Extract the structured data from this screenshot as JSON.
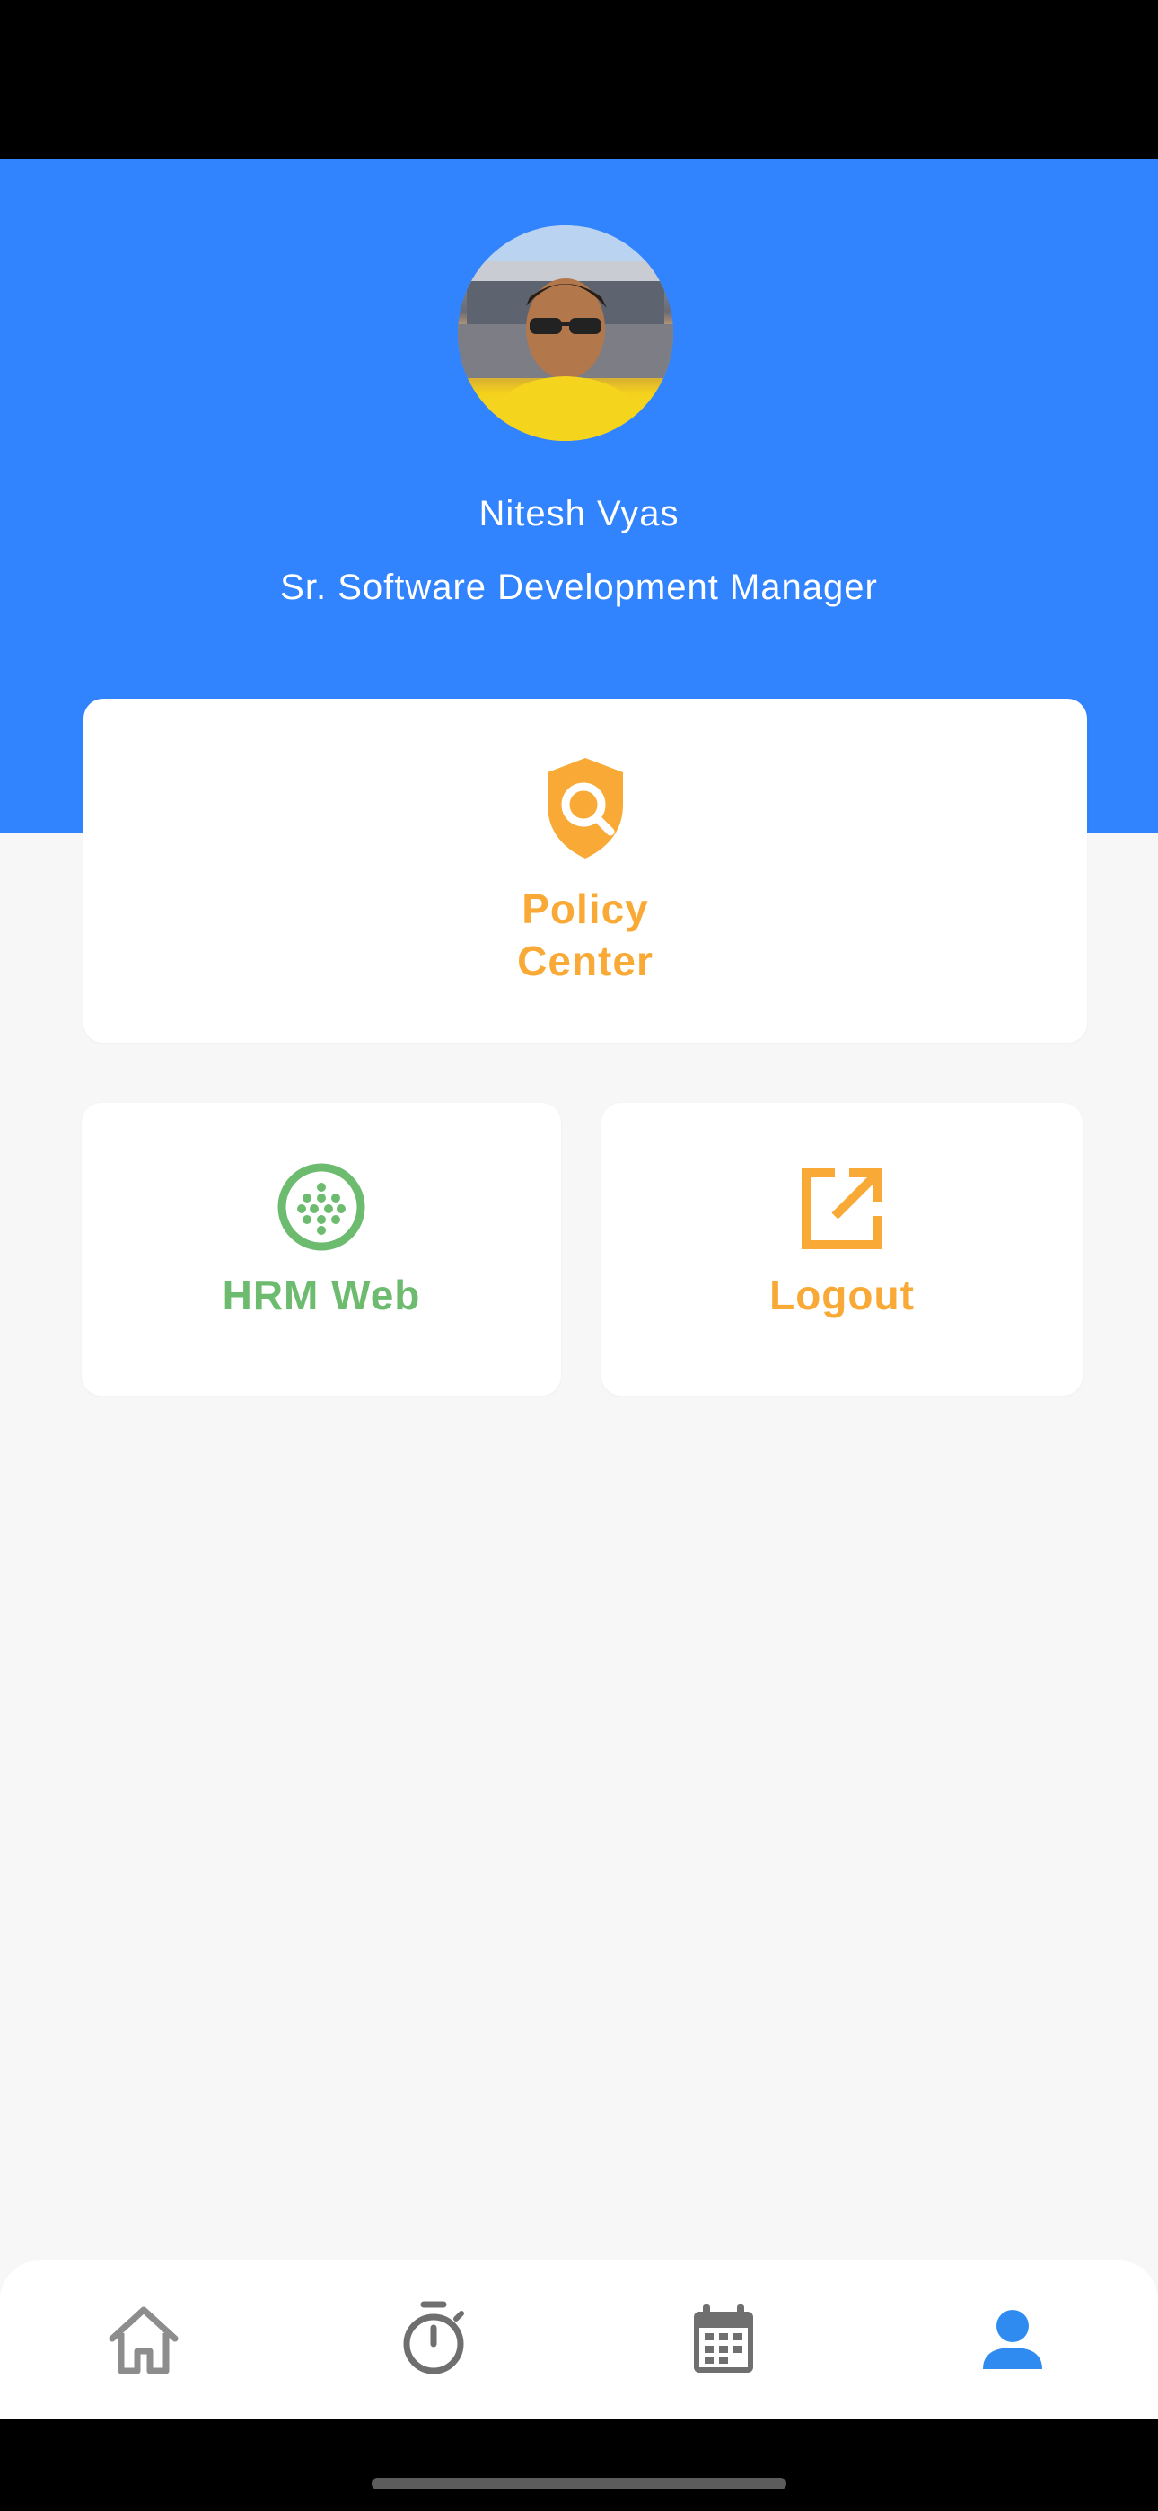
{
  "profile": {
    "name": "Nitesh Vyas",
    "role": "Sr. Software Development Manager"
  },
  "cards": {
    "policy": {
      "line1": "Policy",
      "line2": "Center",
      "icon": "shield-search-icon",
      "color": "#f9aa36"
    },
    "hrm": {
      "label": "HRM Web",
      "icon": "web-grid-icon",
      "color": "#6dbb6f"
    },
    "logout": {
      "label": "Logout",
      "icon": "open-in-new-icon",
      "color": "#f9aa36"
    }
  },
  "bottom_nav": {
    "items": [
      {
        "name": "home",
        "icon": "home-icon",
        "active": false
      },
      {
        "name": "timer",
        "icon": "timer-icon",
        "active": false
      },
      {
        "name": "calendar",
        "icon": "calendar-icon",
        "active": false
      },
      {
        "name": "profile",
        "icon": "person-icon",
        "active": true
      }
    ],
    "active_color": "#2f8bf0",
    "inactive_color": "#8d8d8d"
  },
  "colors": {
    "header": "#3183fe",
    "background": "#f7f7f7"
  }
}
